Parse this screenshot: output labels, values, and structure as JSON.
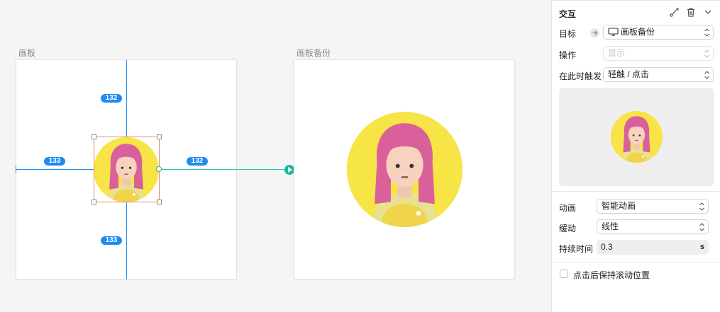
{
  "canvas": {
    "artboards": [
      {
        "title": "画板"
      },
      {
        "title": "画板备份"
      }
    ],
    "measurements": {
      "top": "132",
      "left": "133",
      "right": "132",
      "bottom": "133"
    }
  },
  "panel": {
    "section_title": "交互",
    "header_icons": [
      "bezier-path-icon",
      "trash-icon",
      "chevron-down-icon"
    ],
    "target": {
      "label": "目标",
      "value": "画板备份",
      "icon": "monitor-icon"
    },
    "action": {
      "label": "操作",
      "value": "显示"
    },
    "trigger": {
      "label": "在此时触发",
      "value": "轻触 / 点击"
    },
    "animation": {
      "label": "动画",
      "value": "智能动画"
    },
    "easing": {
      "label": "缓动",
      "value": "线性"
    },
    "duration": {
      "label": "持续时间",
      "value": "0.3",
      "unit": "s"
    },
    "scroll_option": {
      "label": "点击后保持滚动位置",
      "checked": false
    }
  },
  "colors": {
    "guide_blue": "#1f8cf0",
    "prototype_teal": "#1bb99f",
    "avatar_yellow": "#f7e446",
    "selection_orange": "#e88a5e"
  }
}
